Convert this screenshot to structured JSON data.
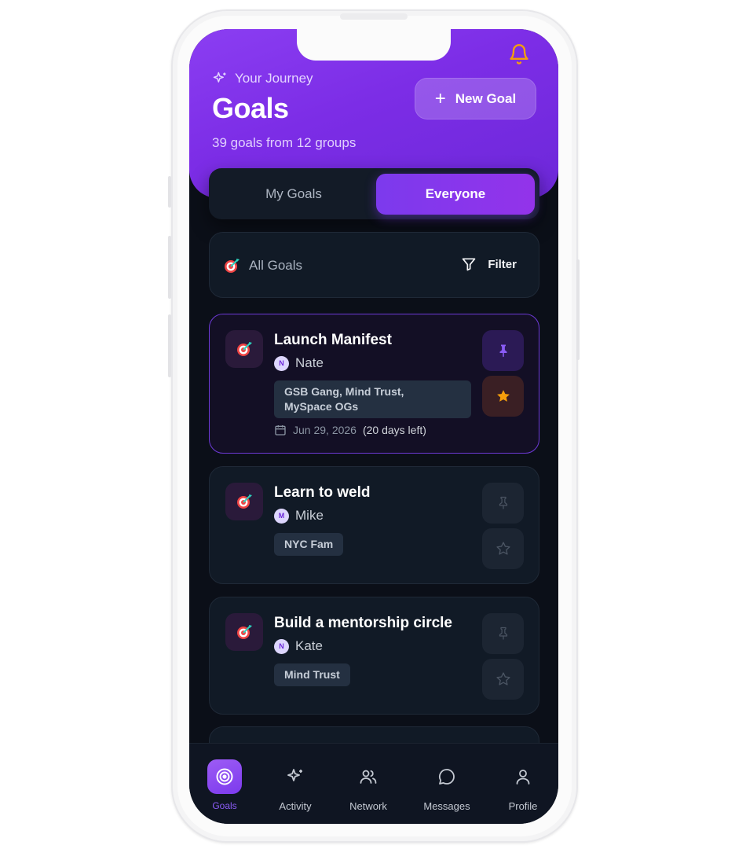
{
  "header": {
    "eyebrow": "Your Journey",
    "title": "Goals",
    "subtitle": "39 goals from 12 groups",
    "new_goal_label": "New Goal",
    "bell_icon": "bell-icon"
  },
  "toggle": {
    "mine_label": "My Goals",
    "everyone_label": "Everyone",
    "selected": "Everyone"
  },
  "filter": {
    "scope_label": "All Goals",
    "filter_label": "Filter"
  },
  "goals": [
    {
      "title": "Launch Manifest",
      "owner": "Nate",
      "owner_initial": "N",
      "groups_line1": "GSB Gang, Mind Trust,",
      "groups_line2": "MySpace OGs",
      "due_date": "Jun 29, 2026",
      "days_left": "(20 days left)",
      "pinned": true,
      "starred": true
    },
    {
      "title": "Learn to weld",
      "owner": "Mike",
      "owner_initial": "M",
      "groups": "NYC Fam",
      "pinned": false,
      "starred": false
    },
    {
      "title": "Build a mentorship circle",
      "owner": "Kate",
      "owner_initial": "N",
      "groups": "Mind Trust",
      "pinned": false,
      "starred": false
    }
  ],
  "tabbar": {
    "goals": "Goals",
    "activity": "Activity",
    "network": "Network",
    "messages": "Messages",
    "profile": "Profile",
    "active": "Goals"
  },
  "colors": {
    "accent": "#7c3aed",
    "background": "#0b0f18",
    "card": "#111a26",
    "star": "#f59e0b"
  }
}
